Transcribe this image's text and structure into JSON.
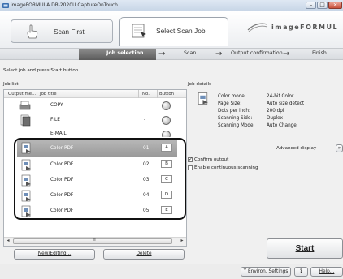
{
  "window": {
    "title": "imageFORMULA DR-2020U CaptureOnTouch"
  },
  "header": {
    "tab_scan_first": "Scan First",
    "tab_select_scan_job": "Select Scan Job",
    "brand": "imageFORMUL"
  },
  "steps": [
    {
      "label": "Job selection",
      "active": true
    },
    {
      "label": "Scan",
      "active": false
    },
    {
      "label": "Output confirmation",
      "active": false
    },
    {
      "label": "Finish",
      "active": false
    }
  ],
  "instruction": "Select job and press Start button.",
  "job_list": {
    "label": "Job list",
    "columns": [
      "Output me...",
      "Job title",
      "No.",
      "Button"
    ],
    "rows": [
      {
        "title": "COPY",
        "no": "-",
        "button": ""
      },
      {
        "title": "FILE",
        "no": "-",
        "button": ""
      },
      {
        "title": "E-MAIL",
        "no": "",
        "button": ""
      },
      {
        "title": "Color PDF",
        "no": "01",
        "button": "A"
      },
      {
        "title": "Color PDF",
        "no": "02",
        "button": "B"
      },
      {
        "title": "Color PDF",
        "no": "03",
        "button": "C"
      },
      {
        "title": "Color PDF",
        "no": "04",
        "button": "D"
      },
      {
        "title": "Color PDF",
        "no": "05",
        "button": "E"
      }
    ],
    "new_editing": "New/Editing...",
    "delete": "Delete"
  },
  "job_details": {
    "label": "Job details",
    "fields": [
      {
        "key": "Color mode:",
        "value": "24-bit Color"
      },
      {
        "key": "Page Size:",
        "value": "Auto size detect"
      },
      {
        "key": "Dots per inch:",
        "value": "200 dpi"
      },
      {
        "key": "Scanning Side:",
        "value": "Duplex"
      },
      {
        "key": "Scanning Mode:",
        "value": "Auto Change"
      }
    ],
    "advanced_display": "Advanced display",
    "confirm_output": "Confirm output",
    "confirm_output_checked": true,
    "enable_continuous": "Enable continuous scanning",
    "enable_continuous_checked": false
  },
  "start": "Start",
  "footer": {
    "environ_settings": "Environ. Settings",
    "help_q": "?",
    "help": "Help..."
  }
}
